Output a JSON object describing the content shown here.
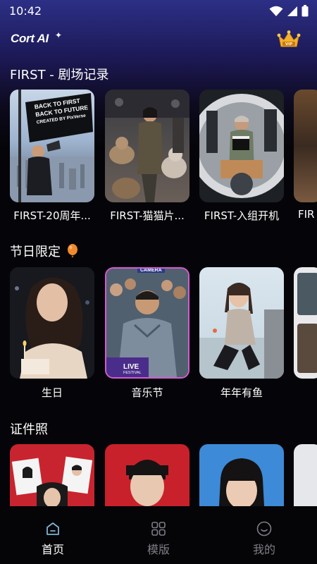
{
  "status_bar": {
    "time": "10:42"
  },
  "header": {
    "logo": "Cort AI",
    "vip_badge": "VIP"
  },
  "sections": [
    {
      "title": "FIRST - 剧场记录",
      "cards": [
        {
          "label": "FIRST-20周年...",
          "banner_lines": [
            "BACK TO FIRST",
            "BACK TO FUTURE",
            "CREATED BY PixVerse"
          ]
        },
        {
          "label": "FIRST-猫猫片..."
        },
        {
          "label": "FIRST-入组开机"
        },
        {
          "label": "FIR"
        }
      ]
    },
    {
      "title": "节日限定",
      "title_icon": "balloon-icon",
      "cards": [
        {
          "label": "生日"
        },
        {
          "label": "音乐节",
          "overlay_text": "LIVE",
          "overlay_subtext": "FESTIVAL",
          "top_text": "CAMERA"
        },
        {
          "label": "年年有鱼"
        },
        {
          "label": ""
        }
      ]
    },
    {
      "title": "证件照",
      "cards": [
        {
          "label": ""
        },
        {
          "label": ""
        },
        {
          "label": ""
        },
        {
          "label": ""
        }
      ]
    }
  ],
  "bottom_nav": [
    {
      "label": "首页",
      "icon": "home-icon",
      "active": true
    },
    {
      "label": "模版",
      "icon": "grid-icon",
      "active": false
    },
    {
      "label": "我的",
      "icon": "smiley-icon",
      "active": false
    }
  ],
  "colors": {
    "nav_active": "#ffffff",
    "nav_inactive": "#7d7d86",
    "accent_orange": "#f08a2c"
  }
}
